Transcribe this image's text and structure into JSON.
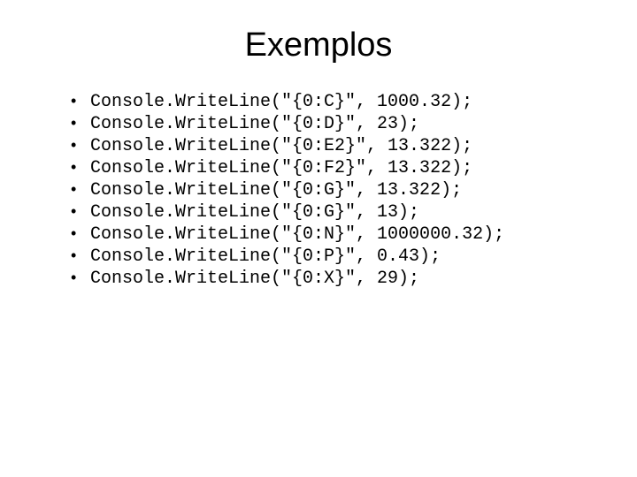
{
  "title": "Exemplos",
  "lines": [
    "Console.WriteLine(\"{0:C}\", 1000.32);",
    "Console.WriteLine(\"{0:D}\", 23);",
    "Console.WriteLine(\"{0:E2}\", 13.322);",
    "Console.WriteLine(\"{0:F2}\", 13.322);",
    "Console.WriteLine(\"{0:G}\", 13.322);",
    "Console.WriteLine(\"{0:G}\", 13);",
    "Console.WriteLine(\"{0:N}\", 1000000.32);",
    "Console.WriteLine(\"{0:P}\", 0.43);",
    "Console.WriteLine(\"{0:X}\", 29);"
  ]
}
